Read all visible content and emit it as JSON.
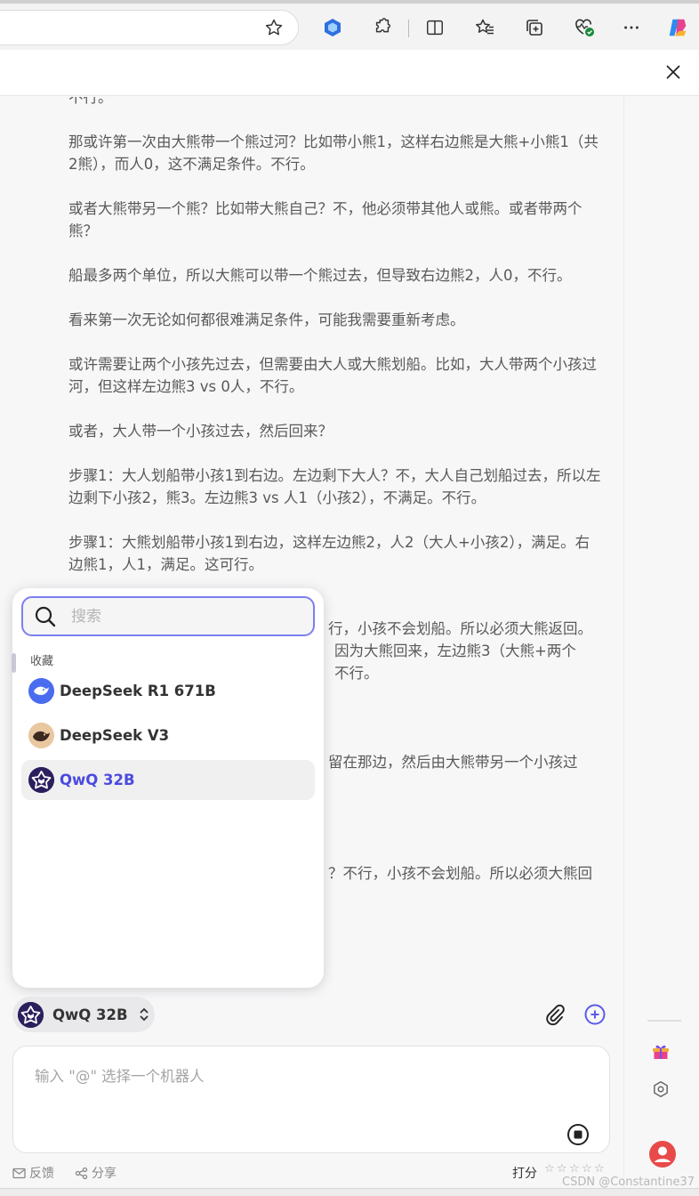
{
  "browser": {
    "icons": [
      "star-favorite-icon",
      "extension-hexagon-icon",
      "puzzle-icon",
      "split-screen-icon",
      "favorites-icon",
      "collections-icon",
      "heart-check-icon",
      "more-icon",
      "copilot-icon"
    ]
  },
  "panel": {
    "close_label": "×"
  },
  "messages": [
    "不行。",
    "那或许第一次由大熊带一个熊过河？比如带小熊1，这样右边熊是大熊+小熊1（共2熊），而人0，这不满足条件。不行。",
    "或者大熊带另一个熊？比如带大熊自己？不，他必须带其他人或熊。或者带两个熊？",
    "船最多两个单位，所以大熊可以带一个熊过去，但导致右边熊2，人0，不行。",
    "看来第一次无论如何都很难满足条件，可能我需要重新考虑。",
    "或许需要让两个小孩先过去，但需要由大人或大熊划船。比如，大人带两个小孩过河，但这样左边熊3 vs 0人，不行。",
    "或者，大人带一个小孩过去，然后回来？",
    "步骤1：大人划船带小孩1到右边。左边剩下大人？不，大人自己划船过去，所以左边剩下小孩2，熊3。左边熊3 vs 人1（小孩2），不满足。不行。",
    "步骤1：大熊划船带小孩1到右边，这样左边熊2，人2（大人+小孩2），满足。右边熊1，人1，满足。这可行。"
  ],
  "hidden_fragments": {
    "f1": "行，小孩不会划船。所以必须大熊返回。",
    "f2": "因为大熊回来，左边熊3（大熊+两个",
    "f3": "不行。",
    "f4": "留在那边，然后由大熊带另一个小孩过",
    "f5": "？不行，小孩不会划船。所以必须大熊回"
  },
  "model_picker": {
    "search_placeholder": "搜索",
    "group_label": "收藏",
    "models": [
      {
        "label": "DeepSeek R1 671B",
        "icon": "deepseek-whale-icon",
        "selected": false
      },
      {
        "label": "DeepSeek V3",
        "icon": "deepseek-v3-icon",
        "selected": false
      },
      {
        "label": "QwQ 32B",
        "icon": "qwq-star-icon",
        "selected": true
      }
    ]
  },
  "bot_chip": {
    "name": "QwQ 32B"
  },
  "composer": {
    "placeholder": "输入 \"@\" 选择一个机器人"
  },
  "footer": {
    "feedback": "反馈",
    "share": "分享",
    "rate": "打分",
    "stars": 5
  },
  "watermark": "CSDN @Constantine37",
  "colors": {
    "accent": "#5b5be8",
    "selected_text": "#4a4ae0",
    "bot_avatar_bg": "#2b1f5e"
  }
}
